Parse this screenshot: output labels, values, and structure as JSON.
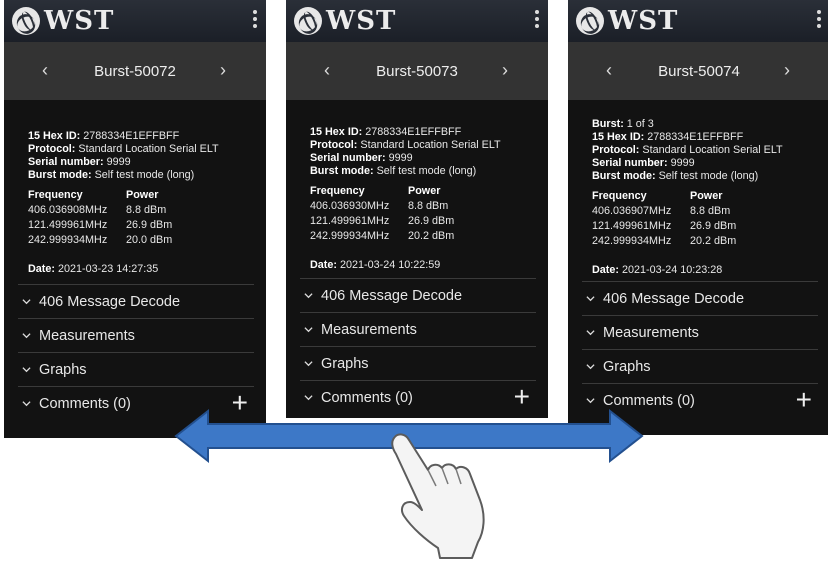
{
  "app": {
    "logo_text": "WST"
  },
  "screens": [
    {
      "nav_title": "Burst-50072",
      "burst": "",
      "hex_id_label": "15 Hex ID:",
      "hex_id": "2788334E1EFFBFF",
      "protocol_label": "Protocol:",
      "protocol": "Standard Location Serial ELT",
      "serial_label": "Serial number:",
      "serial": "9999",
      "mode_label": "Burst mode:",
      "mode": "Self test mode (long)",
      "freq_header": "Frequency",
      "power_header": "Power",
      "rows": [
        {
          "freq": "406.036908MHz",
          "power": "8.8 dBm"
        },
        {
          "freq": "121.499961MHz",
          "power": "26.9 dBm"
        },
        {
          "freq": "242.999934MHz",
          "power": "20.0 dBm"
        }
      ],
      "date_label": "Date:",
      "date": "2021-03-23 14:27:35"
    },
    {
      "nav_title": "Burst-50073",
      "burst": "",
      "hex_id_label": "15 Hex ID:",
      "hex_id": "2788334E1EFFBFF",
      "protocol_label": "Protocol:",
      "protocol": "Standard Location Serial ELT",
      "serial_label": "Serial number:",
      "serial": "9999",
      "mode_label": "Burst mode:",
      "mode": "Self test mode (long)",
      "freq_header": "Frequency",
      "power_header": "Power",
      "rows": [
        {
          "freq": "406.036930MHz",
          "power": "8.8 dBm"
        },
        {
          "freq": "121.499961MHz",
          "power": "26.9 dBm"
        },
        {
          "freq": "242.999934MHz",
          "power": "20.2 dBm"
        }
      ],
      "date_label": "Date:",
      "date": "2021-03-24 10:22:59"
    },
    {
      "nav_title": "Burst-50074",
      "burst_label": "Burst:",
      "burst": "1 of 3",
      "hex_id_label": "15 Hex ID:",
      "hex_id": "2788334E1EFFBFF",
      "protocol_label": "Protocol:",
      "protocol": "Standard Location Serial ELT",
      "serial_label": "Serial number:",
      "serial": "9999",
      "mode_label": "Burst mode:",
      "mode": "Self test mode (long)",
      "freq_header": "Frequency",
      "power_header": "Power",
      "rows": [
        {
          "freq": "406.036907MHz",
          "power": "8.8 dBm"
        },
        {
          "freq": "121.499961MHz",
          "power": "26.9 dBm"
        },
        {
          "freq": "242.999934MHz",
          "power": "20.2 dBm"
        }
      ],
      "date_label": "Date:",
      "date": "2021-03-24 10:23:28"
    }
  ],
  "sections": [
    "406 Message Decode",
    "Measurements",
    "Graphs",
    "Comments (0)"
  ],
  "icons": {
    "prev": "chevron-left-icon",
    "next": "chevron-right-icon",
    "expand": "chevron-down-icon",
    "add": "plus-icon",
    "menu": "kebab-menu-icon"
  },
  "colors": {
    "arrow_fill": "#3d78c7",
    "arrow_stroke": "#23508f",
    "screen_bg": "#121212",
    "nav_bg": "#333333"
  }
}
